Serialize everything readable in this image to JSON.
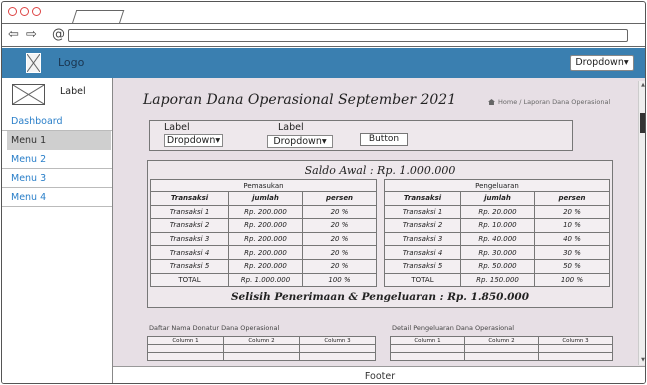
{
  "browser": {
    "back_glyph": "⇦",
    "forward_glyph": "⇨",
    "reload_glyph": "@"
  },
  "header": {
    "logo_text": "Logo",
    "dropdown_label": "Dropdown"
  },
  "sidebar": {
    "label": "Label",
    "items": [
      {
        "label": "Dashboard"
      },
      {
        "label": "Menu 1"
      },
      {
        "label": "Menu 2"
      },
      {
        "label": "Menu 3"
      },
      {
        "label": "Menu 4"
      }
    ]
  },
  "main": {
    "title": "Laporan Dana Operasional September 2021",
    "breadcrumb": {
      "home": "Home",
      "current": "Laporan Dana Operasional"
    },
    "filters": {
      "label1": "Label",
      "dropdown1": "Dropdown",
      "label2": "Label",
      "dropdown2": "Dropdown",
      "button": "Button"
    },
    "report": {
      "saldo_awal": "Saldo Awal : Rp. 1.000.000",
      "pemasukan": {
        "title": "Pemasukan",
        "columns": [
          "Transaksi",
          "jumlah",
          "persen"
        ],
        "rows": [
          [
            "Transaksi 1",
            "Rp. 200.000",
            "20 %"
          ],
          [
            "Transaksi 2",
            "Rp. 200.000",
            "20 %"
          ],
          [
            "Transaksi 3",
            "Rp. 200.000",
            "20 %"
          ],
          [
            "Transaksi 4",
            "Rp. 200.000",
            "20 %"
          ],
          [
            "Transaksi 5",
            "Rp. 200.000",
            "20 %"
          ]
        ],
        "total": [
          "TOTAL",
          "Rp. 1.000.000",
          "100 %"
        ]
      },
      "pengeluaran": {
        "title": "Pengeluaran",
        "columns": [
          "Transaksi",
          "jumlah",
          "persen"
        ],
        "rows": [
          [
            "Transaksi 1",
            "Rp. 20.000",
            "20 %"
          ],
          [
            "Transaksi 2",
            "Rp. 10.000",
            "10 %"
          ],
          [
            "Transaksi 3",
            "Rp. 40.000",
            "40 %"
          ],
          [
            "Transaksi 4",
            "Rp. 30.000",
            "30 %"
          ],
          [
            "Transaksi 5",
            "Rp. 50.000",
            "50 %"
          ]
        ],
        "total": [
          "TOTAL",
          "Rp. 150.000",
          "100 %"
        ]
      },
      "selisih": "Selisih Penerimaan & Pengeluaran : Rp. 1.850.000"
    },
    "donatur": {
      "title": "Daftar Nama Donatur Dana Operasional",
      "columns": [
        "Column 1",
        "Column 2",
        "Column 3"
      ]
    },
    "detail": {
      "title": "Detail Pengeluaran Dana Operasional",
      "columns": [
        "Column 1",
        "Column 2",
        "Column 3"
      ]
    }
  },
  "footer": {
    "text": "Footer"
  }
}
